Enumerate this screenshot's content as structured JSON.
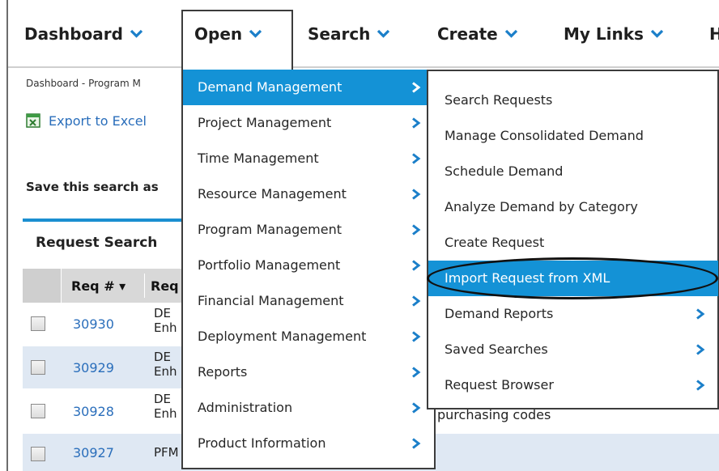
{
  "nav": {
    "items": [
      {
        "label": "Dashboard"
      },
      {
        "label": "Open"
      },
      {
        "label": "Search"
      },
      {
        "label": "Create"
      },
      {
        "label": "My Links"
      },
      {
        "label": "H"
      }
    ]
  },
  "page": {
    "breadcrumb": "Dashboard - Program M",
    "export_label": "Export to Excel",
    "save_search_text": "Save this search as",
    "panel_title": "Request Search",
    "columns": {
      "req_num": "Req # ▾",
      "req_name": "Req"
    },
    "rows": [
      {
        "num": "30930",
        "line1": "DE",
        "line2": "Enh"
      },
      {
        "num": "30929",
        "line1": "DE",
        "line2": "Enh"
      },
      {
        "num": "30928",
        "line1": "DE",
        "line2": "Enh"
      },
      {
        "num": "30927",
        "line1": "PFM",
        "line2": ""
      }
    ],
    "trailing_text": "purchasing codes"
  },
  "open_menu": {
    "items": [
      {
        "label": "Demand Management",
        "has_submenu": true,
        "selected": true
      },
      {
        "label": "Project Management",
        "has_submenu": true
      },
      {
        "label": "Time Management",
        "has_submenu": true
      },
      {
        "label": "Resource Management",
        "has_submenu": true
      },
      {
        "label": "Program Management",
        "has_submenu": true
      },
      {
        "label": "Portfolio Management",
        "has_submenu": true
      },
      {
        "label": "Financial Management",
        "has_submenu": true
      },
      {
        "label": "Deployment Management",
        "has_submenu": true
      },
      {
        "label": "Reports",
        "has_submenu": true
      },
      {
        "label": "Administration",
        "has_submenu": true
      },
      {
        "label": "Product Information",
        "has_submenu": true
      }
    ]
  },
  "demand_menu": {
    "items": [
      {
        "label": "Search Requests"
      },
      {
        "label": "Manage Consolidated Demand"
      },
      {
        "label": "Schedule Demand"
      },
      {
        "label": "Analyze Demand by Category"
      },
      {
        "label": "Create Request"
      },
      {
        "label": "Import Request from XML",
        "selected": true
      },
      {
        "label": "Demand Reports",
        "has_submenu": true
      },
      {
        "label": "Saved Searches",
        "has_submenu": true
      },
      {
        "label": "Request Browser",
        "has_submenu": true
      }
    ]
  },
  "colors": {
    "accent_blue": "#1492d6",
    "link_blue": "#2a6ebb",
    "alt_row": "#dfe8f3",
    "grid_header": "#d8d8d8"
  },
  "icons": {
    "nav_chevron": "chevron-down-icon",
    "submenu_arrow": "chevron-right-icon",
    "excel": "excel-icon"
  }
}
